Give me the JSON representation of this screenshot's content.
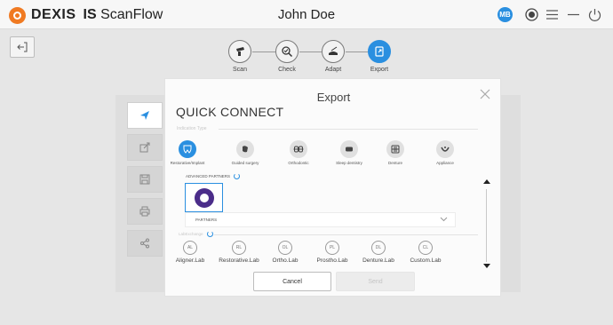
{
  "app": {
    "brand": "DEXIS",
    "product_prefix": "IS",
    "product_name": "ScanFlow",
    "user_name": "John Doe",
    "user_initials": "MB"
  },
  "workflow": {
    "steps": [
      {
        "label": "Scan",
        "icon": "scanner-icon",
        "active": false
      },
      {
        "label": "Check",
        "icon": "check-magnifier-icon",
        "active": false
      },
      {
        "label": "Adapt",
        "icon": "adapt-tray-icon",
        "active": false
      },
      {
        "label": "Export",
        "icon": "export-icon",
        "active": true
      }
    ]
  },
  "modal": {
    "title": "Export",
    "section_title": "QUICK CONNECT",
    "indication_type_label": "Indication Type",
    "indications": [
      {
        "label": "Restorative/Implant",
        "selected": true
      },
      {
        "label": "Guided surgery",
        "selected": false
      },
      {
        "label": "Orthodontic",
        "selected": false
      },
      {
        "label": "Sleep dentistry",
        "selected": false
      },
      {
        "label": "Denture",
        "selected": false
      },
      {
        "label": "Appliance",
        "selected": false
      }
    ],
    "advanced_partners_label": "ADVANCED PARTNERS",
    "partners_select_label": "PARTNERS",
    "labexchange_label": "LabExchange",
    "labs": [
      {
        "abbr": "AL",
        "label": "Aligner.Lab"
      },
      {
        "abbr": "RL",
        "label": "Restorative.Lab"
      },
      {
        "abbr": "OL",
        "label": "Ortho.Lab"
      },
      {
        "abbr": "PL",
        "label": "Prostho.Lab"
      },
      {
        "abbr": "DL",
        "label": "Denture.Lab"
      },
      {
        "abbr": "CL",
        "label": "Custom.Lab"
      }
    ],
    "cancel_label": "Cancel",
    "send_label": "Send"
  },
  "colors": {
    "accent": "#2a8fe0",
    "brand_orange": "#f07a22",
    "partner_logo": "#4b2d8a"
  }
}
